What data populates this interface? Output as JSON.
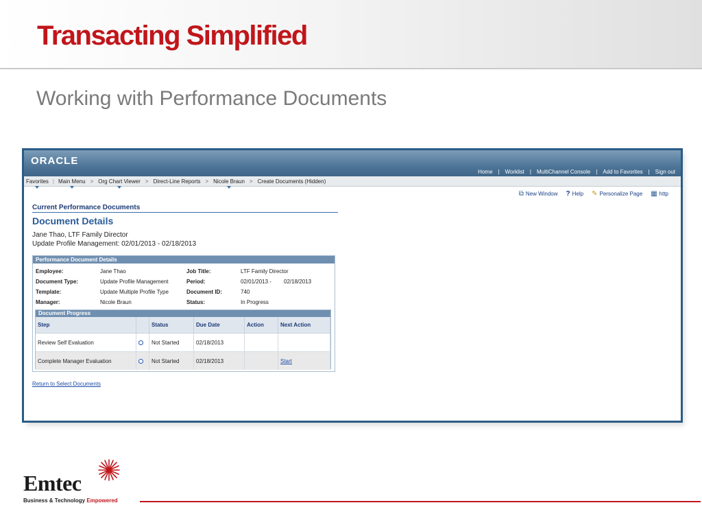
{
  "slide": {
    "title": "Transacting Simplified",
    "subtitle": "Working with Performance Documents"
  },
  "oracle": {
    "logo": "ORACLE",
    "top_links": [
      "Home",
      "Worklist",
      "MultiChannel Console",
      "Add to Favorites",
      "Sign out"
    ]
  },
  "breadcrumb": {
    "favorites": "Favorites",
    "main_menu": "Main Menu",
    "org_chart_viewer": "Org Chart Viewer",
    "direct_line_reports": "Direct-Line Reports",
    "nicole_braun": "Nicole Braun",
    "create_documents": "Create Documents (Hidden)"
  },
  "util_links": {
    "new_window": "New Window",
    "help": "Help",
    "personalize_page": "Personalize Page",
    "http": "http"
  },
  "page": {
    "section_title": "Current Performance Documents",
    "doc_title": "Document Details",
    "employee_line": "Jane Thao, LTF Family Director",
    "profile_line": "Update Profile Management:  02/01/2013 - 02/18/2013"
  },
  "details": {
    "header": "Performance Document Details",
    "employee_label": "Employee:",
    "employee_value": "Jane Thao",
    "doc_type_label": "Document Type:",
    "doc_type_value": "Update Profile Management",
    "template_label": "Template:",
    "template_value": "Update Multiple Profile Type",
    "manager_label": "Manager:",
    "manager_value": "Nicole Braun",
    "job_title_label": "Job Title:",
    "job_title_value": "LTF Family Director",
    "period_label": "Period:",
    "period_start": "02/01/2013 -",
    "period_end": "02/18/2013",
    "doc_id_label": "Document ID:",
    "doc_id_value": "740",
    "status_label": "Status:",
    "status_value": "In Progress"
  },
  "progress": {
    "header": "Document Progress",
    "columns": [
      "Step",
      "Status",
      "Due Date",
      "Action",
      "Next Action"
    ],
    "rows": [
      {
        "step": "Review Self Evaluation",
        "status": "Not Started",
        "due": "02/18/2013",
        "action": "",
        "next_action": ""
      },
      {
        "step": "Complete Manager Evaluation",
        "status": "Not Started",
        "due": "02/18/2013",
        "action": "",
        "next_action": "Start"
      }
    ]
  },
  "return_link": "Return to Select Documents",
  "footer": {
    "brand": "Emtec",
    "tagline_plain": "Business & Technology ",
    "tagline_accent": "Empowered"
  },
  "colors": {
    "title_red": "#c0161b",
    "oracle_blue": "#4f7698",
    "frame_blue": "#2a5c86",
    "link_blue": "#1a4aa8"
  },
  "icons": [
    "new-window-icon",
    "help-icon",
    "personalize-icon",
    "http-icon",
    "radio-icon",
    "emtec-star-icon"
  ]
}
